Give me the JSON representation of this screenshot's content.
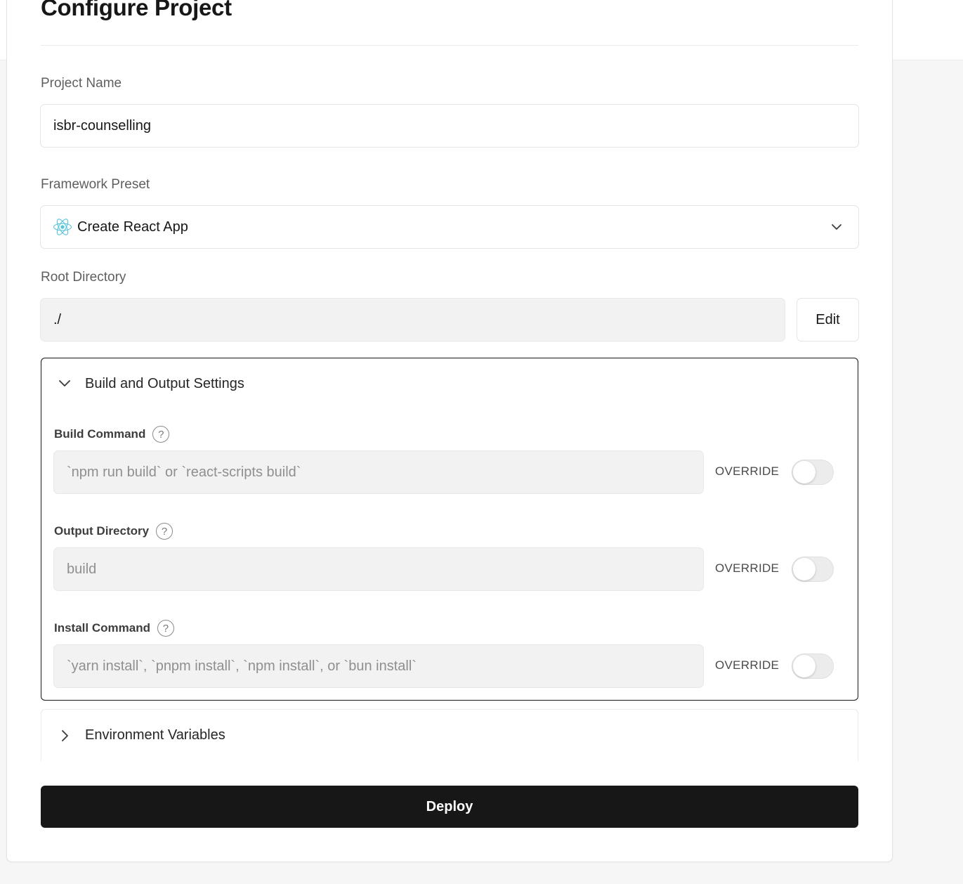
{
  "page": {
    "title": "Configure Project"
  },
  "project_name": {
    "label": "Project Name",
    "value": "isbr-counselling"
  },
  "framework": {
    "label": "Framework Preset",
    "value": "Create React App",
    "icon": "react-icon"
  },
  "root_directory": {
    "label": "Root Directory",
    "value": "./",
    "edit_label": "Edit"
  },
  "build_settings": {
    "title": "Build and Output Settings",
    "expanded": true,
    "build_command": {
      "label": "Build Command",
      "placeholder": "`npm run build` or `react-scripts build`",
      "override_label": "OVERRIDE",
      "override_on": false
    },
    "output_directory": {
      "label": "Output Directory",
      "placeholder": "build",
      "override_label": "OVERRIDE",
      "override_on": false
    },
    "install_command": {
      "label": "Install Command",
      "placeholder": "`yarn install`, `pnpm install`, `npm install`, or `bun install`",
      "override_label": "OVERRIDE",
      "override_on": false
    }
  },
  "env_vars": {
    "title": "Environment Variables",
    "expanded": false
  },
  "deploy": {
    "label": "Deploy"
  },
  "colors": {
    "primary_button": "#171717",
    "react_blue": "#58c4dc"
  }
}
